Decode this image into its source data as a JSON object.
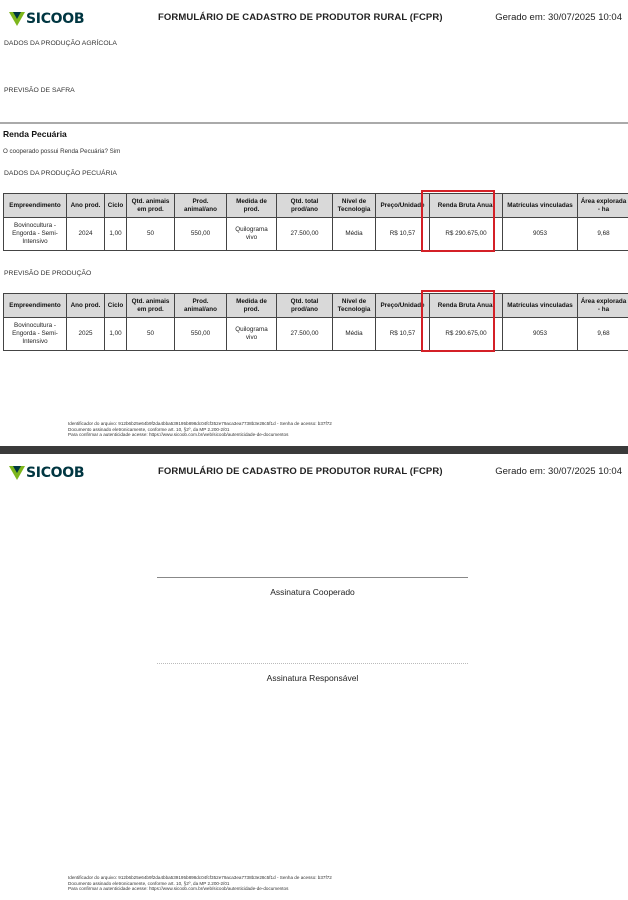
{
  "header": {
    "brand": "SICOOB",
    "title": "FORMULÁRIO DE CADASTRO DE PRODUTOR RURAL (FCPR)",
    "generated": "Gerado em: 30/07/2025 10:04",
    "brand_color": "#003641",
    "brand_accent": "#7DB61C"
  },
  "page1": {
    "agri_section": "DADOS DA PRODUÇÃO AGRÍCOLA",
    "harvest_section": "PREVISÃO DE SAFRA",
    "livestock_title": "Renda Pecuária",
    "livestock_question": "O cooperado possui Renda Pecuária? Sim",
    "livestock_section": "DADOS DA PRODUÇÃO PECUÁRIA",
    "forecast_section": "PREVISÃO DE PRODUÇÃO"
  },
  "table_headers": [
    "Empreendimento",
    "Ano prod.",
    "Ciclo",
    "Qtd. animais em prod.",
    "Prod. animal/ano",
    "Medida de prod.",
    "Qtd. total prod/ano",
    "Nível de Tecnologia",
    "Preço/Unidade",
    "Renda Bruta Anual",
    "Matrículas vinculadas",
    "Área explorada - ha"
  ],
  "table1_row": [
    "Bovinocultura - Engorda - Semi-Intensivo",
    "2024",
    "1,00",
    "50",
    "550,00",
    "Quilograma vivo",
    "27.500,00",
    "Média",
    "R$ 10,57",
    "R$ 290.675,00",
    "9053",
    "9,68"
  ],
  "table2_row": [
    "Bovinocultura - Engorda - Semi-Intensivo",
    "2025",
    "1,00",
    "50",
    "550,00",
    "Quilograma vivo",
    "27.500,00",
    "Média",
    "R$ 10,57",
    "R$ 290.675,00",
    "9053",
    "9,68"
  ],
  "highlight_color": "#D42027",
  "footer": {
    "line1": "Identificador do arquivo: 912b6b25e64b9f2da4bba539195b898dc04fcf352e79aca3ea7738b3e28c5f1d - Senha de acesso: b37f72",
    "line2": "Documento assinado eletronicamente, conforme art. 10, §2º, da MP 2.200-2/01",
    "line3": "Para confirmar a autenticidade acesse: https://www.sicoob.com.br/web/sicoob/autenticidade-de-documentos"
  },
  "page2": {
    "sig_cooperado": "Assinatura Cooperado",
    "sig_responsavel": "Assinatura Responsável"
  }
}
